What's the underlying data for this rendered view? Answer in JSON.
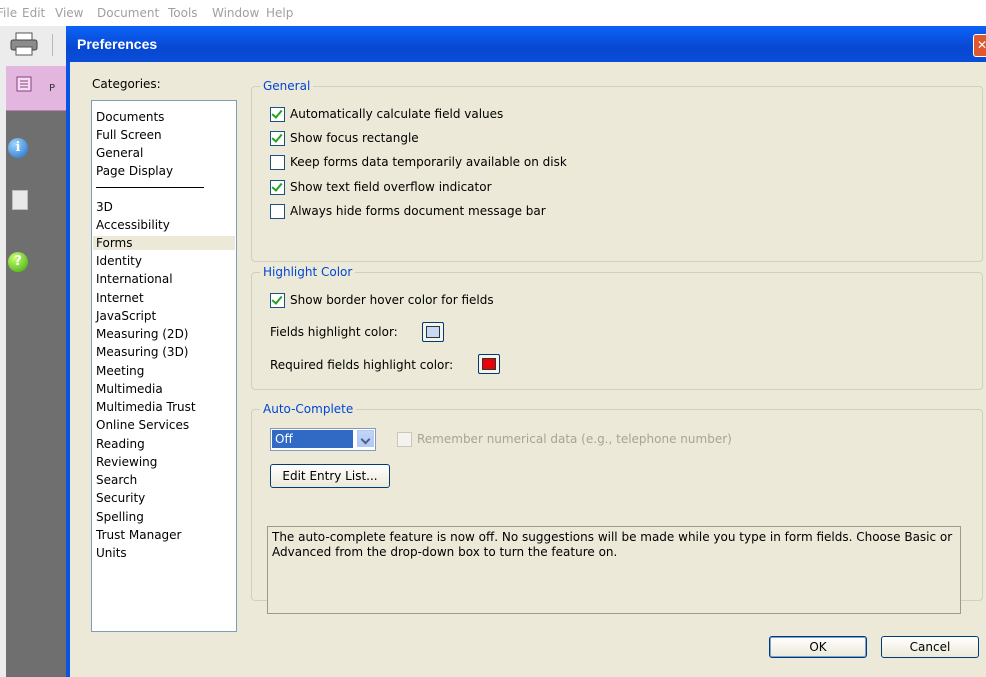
{
  "menubar": {
    "items": [
      "File",
      "Edit",
      "View",
      "Document",
      "Tools",
      "Window",
      "Help"
    ]
  },
  "pages_tab": {
    "letter": "P"
  },
  "dialog": {
    "title": "Preferences",
    "close_glyph": "✕"
  },
  "categories": {
    "label": "Categories:",
    "group1": [
      "Documents",
      "Full Screen",
      "General",
      "Page Display"
    ],
    "group2": [
      "3D",
      "Accessibility",
      "Forms",
      "Identity",
      "International",
      "Internet",
      "JavaScript",
      "Measuring (2D)",
      "Measuring (3D)",
      "Meeting",
      "Multimedia",
      "Multimedia Trust",
      "Online Services",
      "Reading",
      "Reviewing",
      "Search",
      "Security",
      "Spelling",
      "Trust Manager",
      "Units"
    ],
    "selected": "Forms"
  },
  "general": {
    "title": "General",
    "options": [
      {
        "label": "Automatically calculate field values",
        "checked": true
      },
      {
        "label": "Show focus rectangle",
        "checked": true
      },
      {
        "label": "Keep forms data temporarily available on disk",
        "checked": false
      },
      {
        "label": "Show text field overflow indicator",
        "checked": true
      },
      {
        "label": "Always hide forms document message bar",
        "checked": false
      }
    ]
  },
  "highlight": {
    "title": "Highlight Color",
    "border_hover_label": "Show border hover color for fields",
    "border_hover_checked": true,
    "fields_color_label": "Fields highlight color:",
    "fields_color": "#c9d8f4",
    "required_color_label": "Required fields highlight color:",
    "required_color": "#e8000a"
  },
  "autocomplete": {
    "title": "Auto-Complete",
    "mode_value": "Off",
    "remember_label": "Remember numerical data (e.g., telephone number)",
    "remember_checked": false,
    "edit_button": "Edit Entry List...",
    "description": "The auto-complete feature is now off. No suggestions will be made while you type in form fields. Choose Basic or Advanced from the drop-down box to turn the feature on."
  },
  "footer": {
    "ok": "OK",
    "cancel": "Cancel"
  }
}
